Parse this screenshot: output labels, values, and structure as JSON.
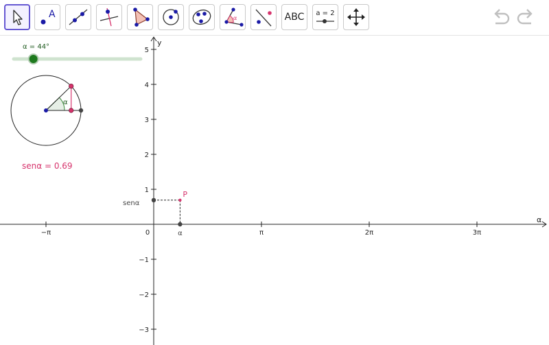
{
  "toolbar": {
    "tools": [
      {
        "name": "move-tool",
        "label": ""
      },
      {
        "name": "point-tool",
        "label": "A"
      },
      {
        "name": "line-tool",
        "label": ""
      },
      {
        "name": "perpendicular-line-tool",
        "label": ""
      },
      {
        "name": "polygon-tool",
        "label": ""
      },
      {
        "name": "circle-tool",
        "label": ""
      },
      {
        "name": "ellipse-tool",
        "label": ""
      },
      {
        "name": "angle-tool",
        "label": "α"
      },
      {
        "name": "reflect-tool",
        "label": ""
      },
      {
        "name": "text-tool",
        "label": "ABC"
      },
      {
        "name": "slider-tool",
        "label": "a = 2"
      },
      {
        "name": "move-graphics-view-tool",
        "label": ""
      }
    ],
    "undo_icon": "undo-icon",
    "redo_icon": "redo-icon"
  },
  "slider": {
    "label": "α = 44°",
    "value_deg": 44,
    "min_deg": 0,
    "max_deg": 360
  },
  "unit_circle": {
    "angle_label": "α"
  },
  "formula": {
    "text": "senα  =  0.69",
    "value": 0.69
  },
  "graph": {
    "x_axis_label": "α",
    "y_axis_label": "y",
    "x_tick_labels": [
      "−π",
      "π",
      "2π",
      "3π"
    ],
    "origin_label": "0",
    "y_tick_labels": [
      "5",
      "4",
      "3",
      "2",
      "1",
      "−1",
      "−2",
      "−3"
    ],
    "point_label": "P",
    "y_marker_label": "senα",
    "x_marker_label": "α",
    "point_x": 0.768,
    "point_y": 0.69
  },
  "colors": {
    "accent": "#6557d2",
    "slider_fill": "#1e7a1e",
    "slider_track": "#cfe3cf",
    "point_red": "#d6336c",
    "point_blue": "#1a1aa6",
    "dark_point": "#444444"
  }
}
